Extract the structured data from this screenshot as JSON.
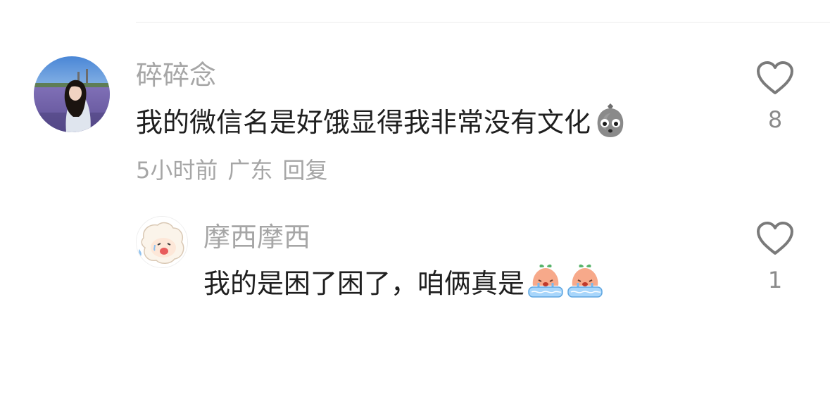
{
  "comments": [
    {
      "username": "碎碎念",
      "text": "我的微信名是好饿显得我非常没有文化",
      "emoji_icon": "sad-rock-emoji",
      "meta": {
        "time": "5小时前",
        "location": "广东",
        "reply_label": "回复"
      },
      "likes": "8"
    },
    {
      "username": "摩西摩西",
      "text": "我的是困了困了，咱俩真是",
      "emoji_icon": "crying-peach-emoji",
      "likes": "1"
    }
  ],
  "colors": {
    "username": "#a6a6a6",
    "text": "#1f1f1f",
    "meta": "#a6a6a6",
    "heart": "#7a7a7a"
  }
}
